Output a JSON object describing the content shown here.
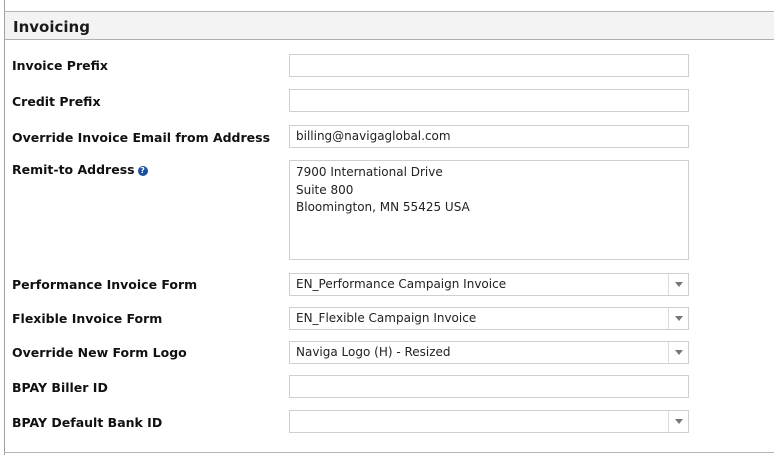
{
  "section": {
    "title": "Invoicing"
  },
  "fields": {
    "invoice_prefix": {
      "label": "Invoice Prefix",
      "value": ""
    },
    "credit_prefix": {
      "label": "Credit Prefix",
      "value": ""
    },
    "override_email": {
      "label": "Override Invoice Email from Address",
      "value": "billing@navigaglobal.com"
    },
    "remit_to": {
      "label": "Remit-to Address",
      "help": "?",
      "value": "7900 International Drive\nSuite 800\nBloomington, MN 55425 USA"
    },
    "performance_form": {
      "label": "Performance Invoice Form",
      "value": "EN_Performance Campaign Invoice"
    },
    "flexible_form": {
      "label": "Flexible Invoice Form",
      "value": "EN_Flexible Campaign Invoice"
    },
    "override_logo": {
      "label": "Override New Form Logo",
      "value": "Naviga Logo (H) - Resized"
    },
    "bpay_biller": {
      "label": "BPAY Biller ID",
      "value": ""
    },
    "bpay_bank": {
      "label": "BPAY Default Bank ID",
      "value": ""
    }
  }
}
